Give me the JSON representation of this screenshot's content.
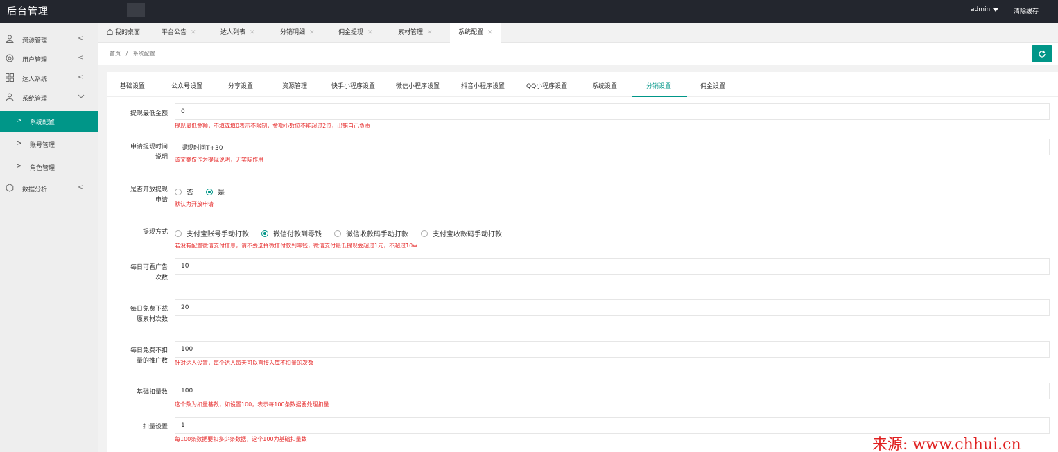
{
  "header": {
    "title": "后台管理",
    "user": "admin",
    "clear_cache": "清除缓存"
  },
  "sidebar": {
    "items": [
      {
        "label": "资源管理",
        "icon": "user-icon"
      },
      {
        "label": "用户管理",
        "icon": "settings-icon"
      },
      {
        "label": "达人系统",
        "icon": "grid-icon"
      },
      {
        "label": "系统管理",
        "icon": "user-icon"
      }
    ],
    "sub_items": [
      {
        "label": "系统配置"
      },
      {
        "label": "账号管理"
      },
      {
        "label": "角色管理"
      }
    ],
    "analytics": {
      "label": "数据分析",
      "icon": "hexagon-icon"
    }
  },
  "tabs": [
    {
      "label": "我的桌面"
    },
    {
      "label": "平台公告"
    },
    {
      "label": "达人列表"
    },
    {
      "label": "分销明细"
    },
    {
      "label": "佣金提现"
    },
    {
      "label": "素材管理"
    },
    {
      "label": "系统配置"
    }
  ],
  "breadcrumb": {
    "home": "首页",
    "sep": "/",
    "current": "系统配置"
  },
  "settings_tabs": [
    "基础设置",
    "公众号设置",
    "分享设置",
    "资源管理",
    "快手小程序设置",
    "微信小程序设置",
    "抖音小程序设置",
    "QQ小程序设置",
    "系统设置",
    "分销设置",
    "佣金设置"
  ],
  "form": {
    "min_withdraw": {
      "label": "提现最低金额",
      "value": "0",
      "hint": "提现最低金额，不填或填0表示不限制，金额小数位不能超过2位，出错自己负责"
    },
    "withdraw_time": {
      "label_line1": "申请提现时间",
      "label_line2": "说明",
      "value": "提现时间T+30",
      "hint": "该文案仅作为提现说明，无实际作用"
    },
    "open_withdraw": {
      "label_line1": "是否开放提现",
      "label_line2": "申请",
      "options": [
        "否",
        "是"
      ],
      "selected": "是",
      "hint": "默认为开放申请"
    },
    "withdraw_method": {
      "label": "提现方式",
      "options": [
        "支付宝账号手动打款",
        "微信付款到零钱",
        "微信收款码手动打款",
        "支付宝收款码手动打款"
      ],
      "selected": "微信付款到零钱",
      "hint": "若没有配置微信支付信息，请不要选择微信付款到零钱，微信支付最低提现要超过1元，不超过10w"
    },
    "daily_ads": {
      "label_line1": "每日可看广告",
      "label_line2": "次数",
      "value": "10"
    },
    "daily_free_download": {
      "label_line1": "每日免费下载",
      "label_line2": "原素材次数",
      "value": "20"
    },
    "daily_free_promo": {
      "label_line1": "每日免费不扣",
      "label_line2": "量的推广数",
      "value": "100",
      "hint": "针对达人设置，每个达人每天可以直接入库不扣量的次数"
    },
    "base_deduct": {
      "label": "基础扣量数",
      "value": "100",
      "hint": "这个数为扣量基数，如设置100，表示每100条数据要处理扣量"
    },
    "deduct_setting": {
      "label": "扣量设置",
      "value": "1",
      "hint": "每100条数据要扣多少条数据，这个100为基础扣量数"
    }
  },
  "watermark": "来源: www.chhui.cn",
  "colors": {
    "accent": "#009688",
    "topbar": "#23262e",
    "hint": "#e62d2d"
  }
}
